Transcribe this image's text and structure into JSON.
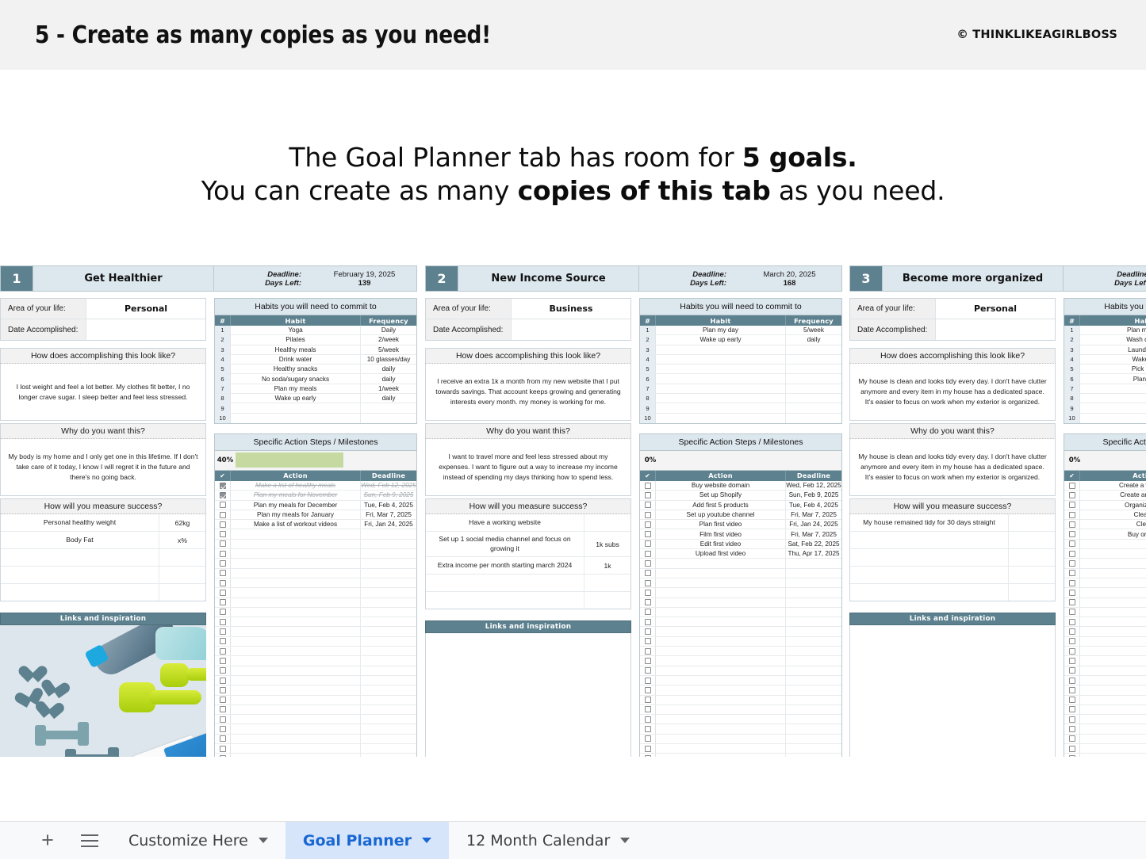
{
  "banner": {
    "title": "5 - Create as many copies as you need!",
    "credit": "© THINKLIKEAGIRLBOSS"
  },
  "headline": {
    "line1_a": "The Goal Planner tab has room for ",
    "line1_b": "5 goals.",
    "line2_a": "You can create as many ",
    "line2_b": "copies of this tab",
    "line2_c": " as you need."
  },
  "labels": {
    "area_of_life": "Area of your life:",
    "date_accomplished": "Date Accomplished:",
    "deadline": "Deadline:",
    "days_left": "Days Left:",
    "look_like": "How does accomplishing this look like?",
    "why": "Why do you want this?",
    "measure": "How will you measure success?",
    "links": "Links and inspiration",
    "habits_title": "Habits you will need to commit to",
    "actions_title": "Specific Action Steps / Milestones",
    "col_num": "#",
    "col_habit": "Habit",
    "col_frequency": "Frequency",
    "col_check": "✔",
    "col_action": "Action",
    "col_deadline": "Deadline"
  },
  "colors": {
    "accent_teal": "#5d818e",
    "header_blue": "#dde7ee",
    "progress_green": "#c6d9a1",
    "tab_active_bg": "#d7e5fb",
    "tab_active_text": "#1967d2"
  },
  "cards": [
    {
      "number": "1",
      "title": "Get Healthier",
      "deadline": "February 19, 2025",
      "days_left": "139",
      "area": "Personal",
      "date_accomplished": "",
      "look_like": "I lost weight and feel a lot better. My clothes fit better, I no longer crave sugar. I sleep better and feel less stressed.",
      "why": "My body is my home and I only get one in this lifetime. If I don't take care of it today, I know I will regret it in the future and there's no going back.",
      "metrics": [
        {
          "name": "Personal healthy weight",
          "value": "62kg"
        },
        {
          "name": "Body Fat",
          "value": "x%"
        },
        {
          "name": "",
          "value": ""
        },
        {
          "name": "",
          "value": ""
        },
        {
          "name": "",
          "value": ""
        }
      ],
      "has_photo": true,
      "habits": [
        {
          "n": "1",
          "habit": "Yoga",
          "freq": "Daily"
        },
        {
          "n": "2",
          "habit": "Pilates",
          "freq": "2/week"
        },
        {
          "n": "3",
          "habit": "Healthy meals",
          "freq": "5/week"
        },
        {
          "n": "4",
          "habit": "Drink water",
          "freq": "10 glasses/day"
        },
        {
          "n": "5",
          "habit": "Healthy snacks",
          "freq": "daily"
        },
        {
          "n": "6",
          "habit": "No soda/sugary snacks",
          "freq": "daily"
        },
        {
          "n": "7",
          "habit": "Plan my meals",
          "freq": "1/week"
        },
        {
          "n": "8",
          "habit": "Wake up early",
          "freq": "daily"
        },
        {
          "n": "9",
          "habit": "",
          "freq": ""
        },
        {
          "n": "10",
          "habit": "",
          "freq": ""
        }
      ],
      "progress": "40%",
      "progress_fill": 60,
      "actions": [
        {
          "done": true,
          "action": "Make a list of healthy meals",
          "deadline": "Wed, Feb 12, 2025"
        },
        {
          "done": true,
          "action": "Plan my meals for November",
          "deadline": "Sun, Feb 9, 2025"
        },
        {
          "done": false,
          "action": "Plan my meals for December",
          "deadline": "Tue, Feb 4, 2025"
        },
        {
          "done": false,
          "action": "Plan my meals for January",
          "deadline": "Fri, Mar 7, 2025"
        },
        {
          "done": false,
          "action": "Make a list of workout videos",
          "deadline": "Fri, Jan 24, 2025"
        }
      ],
      "empty_action_rows": 25
    },
    {
      "number": "2",
      "title": "New Income Source",
      "deadline": "March 20, 2025",
      "days_left": "168",
      "area": "Business",
      "date_accomplished": "",
      "look_like": "I receive an extra 1k a month from my new website that I put towards savings. That account keeps growing and generating interests every month. my money is working for me.",
      "why": "I want to travel more and feel less stressed about my expenses. I want to figure out a way to increase my income instead of spending my days thinking how to spend less.",
      "metrics": [
        {
          "name": "Have a working website",
          "value": ""
        },
        {
          "name": "Set up 1 social media channel and focus on growing it",
          "value": "1k subs"
        },
        {
          "name": "Extra income per month starting march 2024",
          "value": "1k"
        },
        {
          "name": "",
          "value": ""
        },
        {
          "name": "",
          "value": ""
        }
      ],
      "has_photo": false,
      "habits": [
        {
          "n": "1",
          "habit": "Plan my day",
          "freq": "5/week"
        },
        {
          "n": "2",
          "habit": "Wake up early",
          "freq": "daily"
        },
        {
          "n": "3",
          "habit": "",
          "freq": ""
        },
        {
          "n": "4",
          "habit": "",
          "freq": ""
        },
        {
          "n": "5",
          "habit": "",
          "freq": ""
        },
        {
          "n": "6",
          "habit": "",
          "freq": ""
        },
        {
          "n": "7",
          "habit": "",
          "freq": ""
        },
        {
          "n": "8",
          "habit": "",
          "freq": ""
        },
        {
          "n": "9",
          "habit": "",
          "freq": ""
        },
        {
          "n": "10",
          "habit": "",
          "freq": ""
        }
      ],
      "progress": "0%",
      "progress_fill": 0,
      "actions": [
        {
          "done": false,
          "action": "Buy website domain",
          "deadline": "Wed, Feb 12, 2025"
        },
        {
          "done": false,
          "action": "Set up Shopify",
          "deadline": "Sun, Feb 9, 2025"
        },
        {
          "done": false,
          "action": "Add first 5 products",
          "deadline": "Tue, Feb 4, 2025"
        },
        {
          "done": false,
          "action": "Set up youtube channel",
          "deadline": "Fri, Mar 7, 2025"
        },
        {
          "done": false,
          "action": "Plan first video",
          "deadline": "Fri, Jan 24, 2025"
        },
        {
          "done": false,
          "action": "Film first video",
          "deadline": "Fri, Mar 7, 2025"
        },
        {
          "done": false,
          "action": "Edit first video",
          "deadline": "Sat, Feb 22, 2025"
        },
        {
          "done": false,
          "action": "Upload first video",
          "deadline": "Thu, Apr 17, 2025"
        }
      ],
      "empty_action_rows": 22
    },
    {
      "number": "3",
      "title": "Become more organized",
      "deadline": "",
      "days_left": "",
      "area": "Personal",
      "date_accomplished": "",
      "look_like": "My house is clean and looks tidy every day. I don't have clutter anymore and every item in my house has a dedicated space. It's easier to focus on work when my exterior is organized.",
      "why": "My house is clean and looks tidy every day. I don't have clutter anymore and every item in my house has a dedicated space. It's easier to focus on work when my exterior is organized.",
      "metrics": [
        {
          "name": "My house remained tidy for 30 days straight",
          "value": ""
        },
        {
          "name": "",
          "value": ""
        },
        {
          "name": "",
          "value": ""
        },
        {
          "name": "",
          "value": ""
        },
        {
          "name": "",
          "value": ""
        }
      ],
      "has_photo": false,
      "habits": [
        {
          "n": "1",
          "habit": "Plan my day",
          "freq": ""
        },
        {
          "n": "2",
          "habit": "Wash dishes",
          "freq": ""
        },
        {
          "n": "3",
          "habit": "Laundry my",
          "freq": ""
        },
        {
          "n": "4",
          "habit": "Wake up",
          "freq": ""
        },
        {
          "n": "5",
          "habit": "Pick up c",
          "freq": ""
        },
        {
          "n": "6",
          "habit": "Plan my",
          "freq": ""
        },
        {
          "n": "7",
          "habit": "",
          "freq": ""
        },
        {
          "n": "8",
          "habit": "",
          "freq": ""
        },
        {
          "n": "9",
          "habit": "",
          "freq": ""
        },
        {
          "n": "10",
          "habit": "",
          "freq": ""
        }
      ],
      "progress": "0%",
      "progress_fill": 0,
      "actions": [
        {
          "done": false,
          "action": "Create a weekly c",
          "deadline": ""
        },
        {
          "done": false,
          "action": "Create an annual",
          "deadline": ""
        },
        {
          "done": false,
          "action": "Organize laun",
          "deadline": ""
        },
        {
          "done": false,
          "action": "Clean c",
          "deadline": ""
        },
        {
          "done": false,
          "action": "Clean",
          "deadline": ""
        },
        {
          "done": false,
          "action": "Buy organiz",
          "deadline": ""
        }
      ],
      "empty_action_rows": 24
    }
  ],
  "tabbar": {
    "add_label": "+",
    "menu_label": "all-sheets",
    "tabs": [
      {
        "label": "Customize Here",
        "active": false
      },
      {
        "label": "Goal Planner",
        "active": true
      },
      {
        "label": "12 Month Calendar",
        "active": false
      }
    ]
  }
}
